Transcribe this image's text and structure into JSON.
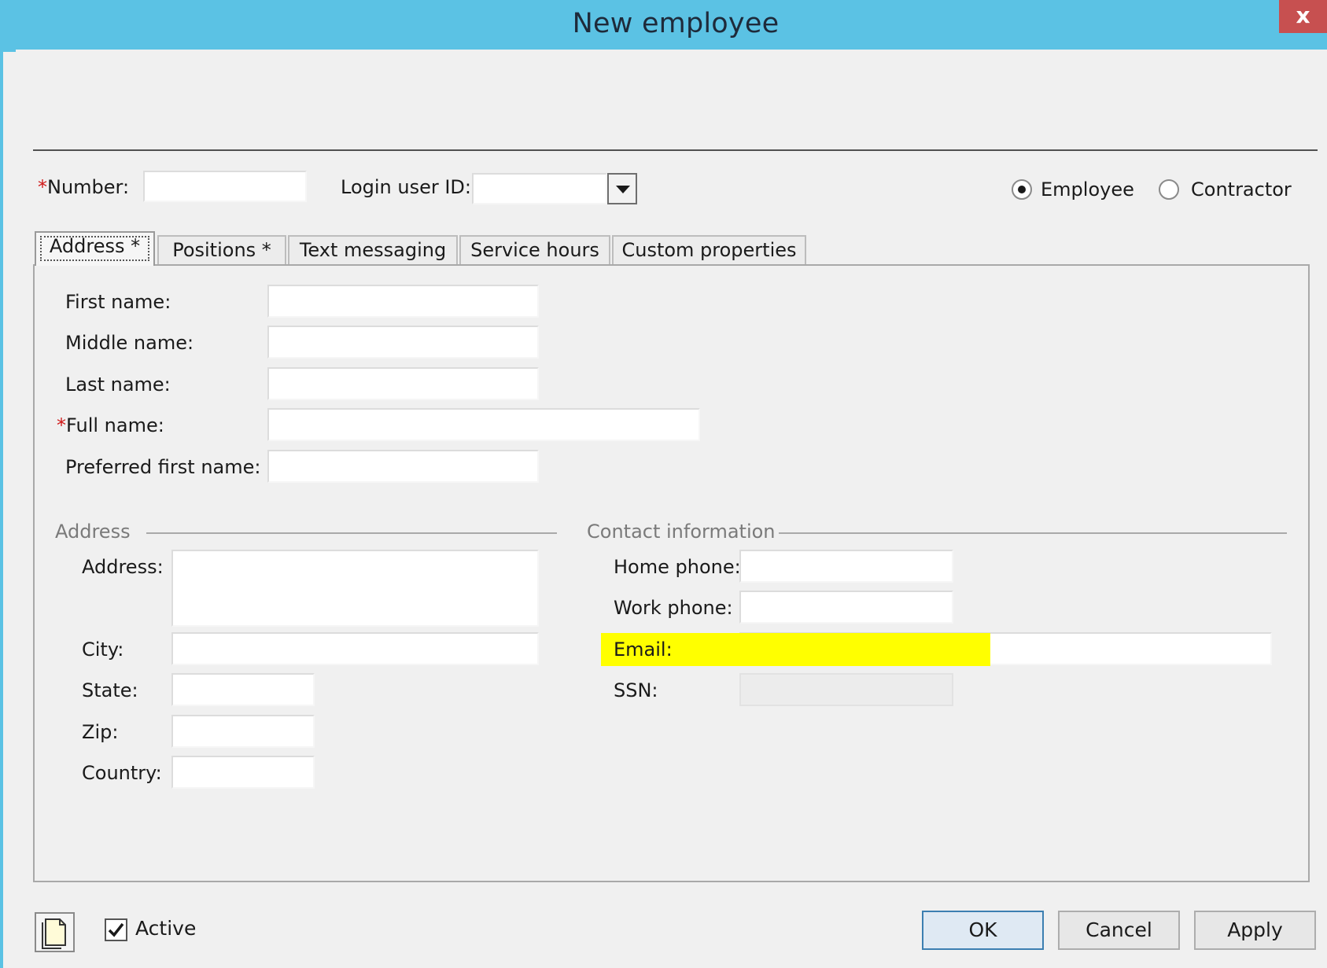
{
  "window": {
    "title": "New employee",
    "close_label": "x"
  },
  "header": {
    "number_label": "Number:",
    "number_required_mark": "*",
    "number_value": "",
    "login_label": "Login user ID:",
    "login_value": "",
    "radio_employee": "Employee",
    "radio_contractor": "Contractor",
    "selected_type": "Employee"
  },
  "tabs": [
    {
      "label": "Address *",
      "active": true
    },
    {
      "label": "Positions *",
      "active": false
    },
    {
      "label": "Text messaging",
      "active": false
    },
    {
      "label": "Service hours",
      "active": false
    },
    {
      "label": "Custom properties",
      "active": false
    }
  ],
  "name_fields": {
    "first_name": {
      "label": "First name:",
      "value": ""
    },
    "middle_name": {
      "label": "Middle name:",
      "value": ""
    },
    "last_name": {
      "label": "Last name:",
      "value": ""
    },
    "full_name": {
      "label": "Full name:",
      "required_mark": "*",
      "value": ""
    },
    "preferred_first_name": {
      "label": "Preferred first name:",
      "value": ""
    }
  },
  "address_group": {
    "title": "Address",
    "address": {
      "label": "Address:",
      "value": ""
    },
    "city": {
      "label": "City:",
      "value": ""
    },
    "state": {
      "label": "State:",
      "value": ""
    },
    "zip": {
      "label": "Zip:",
      "value": ""
    },
    "country": {
      "label": "Country:",
      "value": ""
    }
  },
  "contact_group": {
    "title": "Contact information",
    "home_phone": {
      "label": "Home phone:",
      "value": ""
    },
    "work_phone": {
      "label": "Work phone:",
      "value": ""
    },
    "email": {
      "label": "Email:",
      "value": ""
    },
    "ssn": {
      "label": "SSN:",
      "value": ""
    }
  },
  "footer": {
    "active_label": "Active",
    "active_checked": true,
    "ok_label": "OK",
    "cancel_label": "Cancel",
    "apply_label": "Apply"
  },
  "colors": {
    "titlebar": "#5bc2e4",
    "close_button": "#c75050",
    "highlight": "#ffff00",
    "required": "#d01818"
  },
  "icons": {
    "close": "close-icon",
    "dropdown": "chevron-down-icon",
    "document": "document-icon",
    "checkmark": "checkmark-icon"
  }
}
